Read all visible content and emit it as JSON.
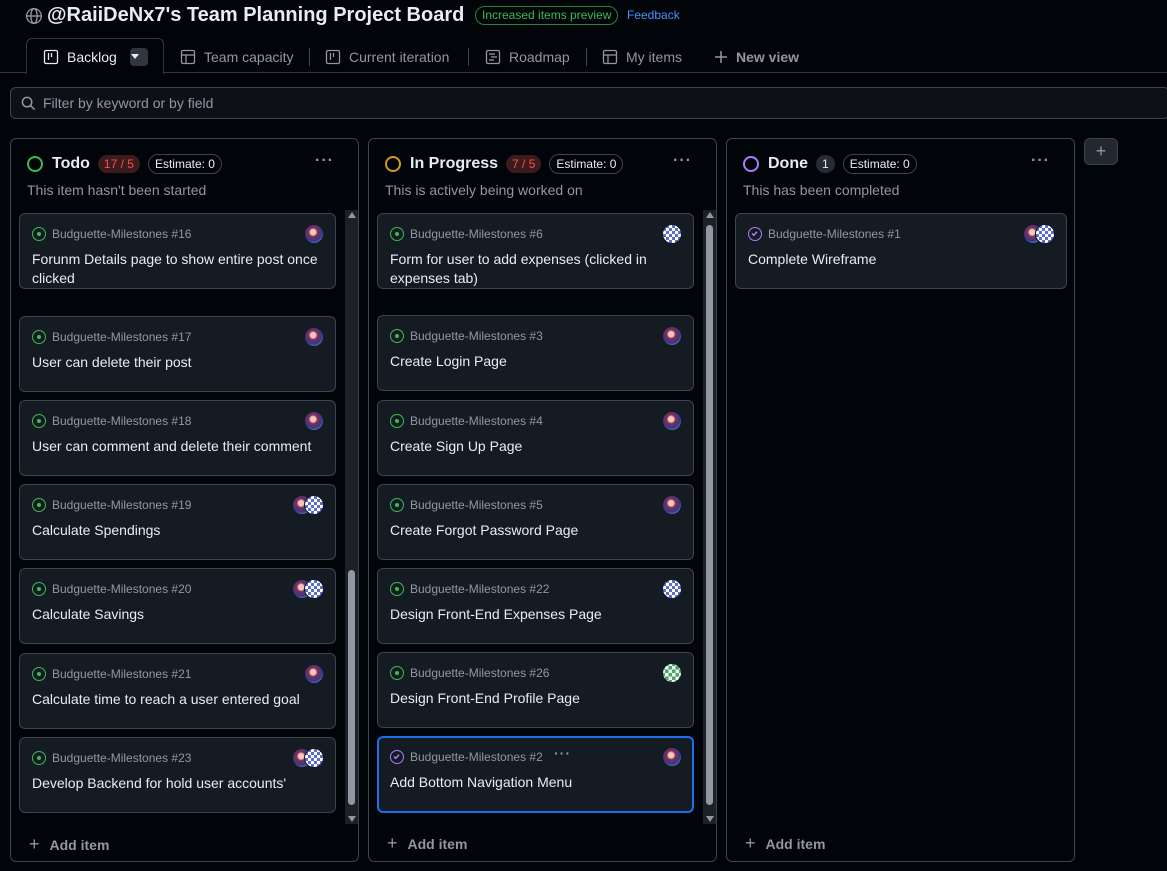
{
  "header": {
    "title": "@RaiiDeNx7's Team Planning Project Board",
    "preview_badge": "Increased items preview",
    "feedback_link": "Feedback"
  },
  "tabs": [
    {
      "label": "Backlog",
      "icon": "board-icon",
      "active": true
    },
    {
      "label": "Team capacity",
      "icon": "table-icon"
    },
    {
      "label": "Current iteration",
      "icon": "board-icon"
    },
    {
      "label": "Roadmap",
      "icon": "roadmap-icon"
    },
    {
      "label": "My items",
      "icon": "table-icon"
    },
    {
      "label": "New view",
      "icon": "plus-icon"
    }
  ],
  "filter": {
    "placeholder": "Filter by keyword or by field"
  },
  "colors": {
    "accent": "#1f6feb",
    "open": "#3fb950",
    "closed": "#ab7df8",
    "todo": "#3fb950",
    "in_progress": "#d29922",
    "done": "#ab7df8"
  },
  "columns": [
    {
      "title": "Todo",
      "count": "17 / 5",
      "estimate": "Estimate: 0",
      "description": "This item hasn't been started",
      "add_item": "Add item",
      "cards": [
        {
          "ref": "Budguette-Milestones #16",
          "title": "Forunm Details page to show entire post once clicked",
          "state": "open",
          "avatars": [
            "photo"
          ]
        },
        {
          "ref": "Budguette-Milestones #17",
          "title": "User can delete their post",
          "state": "open",
          "avatars": [
            "photo"
          ]
        },
        {
          "ref": "Budguette-Milestones #18",
          "title": "User can comment and delete their comment",
          "state": "open",
          "avatars": [
            "photo"
          ]
        },
        {
          "ref": "Budguette-Milestones #19",
          "title": "Calculate Spendings",
          "state": "open",
          "avatars": [
            "photo",
            "grid"
          ]
        },
        {
          "ref": "Budguette-Milestones #20",
          "title": "Calculate Savings",
          "state": "open",
          "avatars": [
            "photo",
            "grid"
          ]
        },
        {
          "ref": "Budguette-Milestones #21",
          "title": "Calculate time to reach a user entered goal",
          "state": "open",
          "avatars": [
            "photo"
          ]
        },
        {
          "ref": "Budguette-Milestones #23",
          "title": "Develop Backend for hold user accounts'",
          "state": "open",
          "avatars": [
            "photo",
            "grid"
          ]
        }
      ]
    },
    {
      "title": "In Progress",
      "count": "7 / 5",
      "estimate": "Estimate: 0",
      "description": "This is actively being worked on",
      "add_item": "Add item",
      "cards": [
        {
          "ref": "Budguette-Milestones #6",
          "title": "Form for user to add expenses (clicked in expenses tab)",
          "state": "open",
          "avatars": [
            "grid"
          ]
        },
        {
          "ref": "Budguette-Milestones #3",
          "title": "Create Login Page",
          "state": "open",
          "avatars": [
            "photo"
          ]
        },
        {
          "ref": "Budguette-Milestones #4",
          "title": "Create Sign Up Page",
          "state": "open",
          "avatars": [
            "photo"
          ]
        },
        {
          "ref": "Budguette-Milestones #5",
          "title": "Create Forgot Password Page",
          "state": "open",
          "avatars": [
            "photo"
          ]
        },
        {
          "ref": "Budguette-Milestones #22",
          "title": "Design Front-End Expenses Page",
          "state": "open",
          "avatars": [
            "grid"
          ]
        },
        {
          "ref": "Budguette-Milestones #26",
          "title": "Design Front-End Profile Page",
          "state": "open",
          "avatars": [
            "green"
          ]
        },
        {
          "ref": "Budguette-Milestones #2",
          "title": "Add Bottom Navigation Menu",
          "state": "closed",
          "avatars": [
            "photo"
          ],
          "selected": true
        }
      ]
    },
    {
      "title": "Done",
      "count": "1",
      "estimate": "Estimate: 0",
      "description": "This has been completed",
      "add_item": "Add item",
      "cards": [
        {
          "ref": "Budguette-Milestones #1",
          "title": "Complete Wireframe",
          "state": "closed",
          "avatars": [
            "photo",
            "grid"
          ]
        }
      ]
    }
  ]
}
